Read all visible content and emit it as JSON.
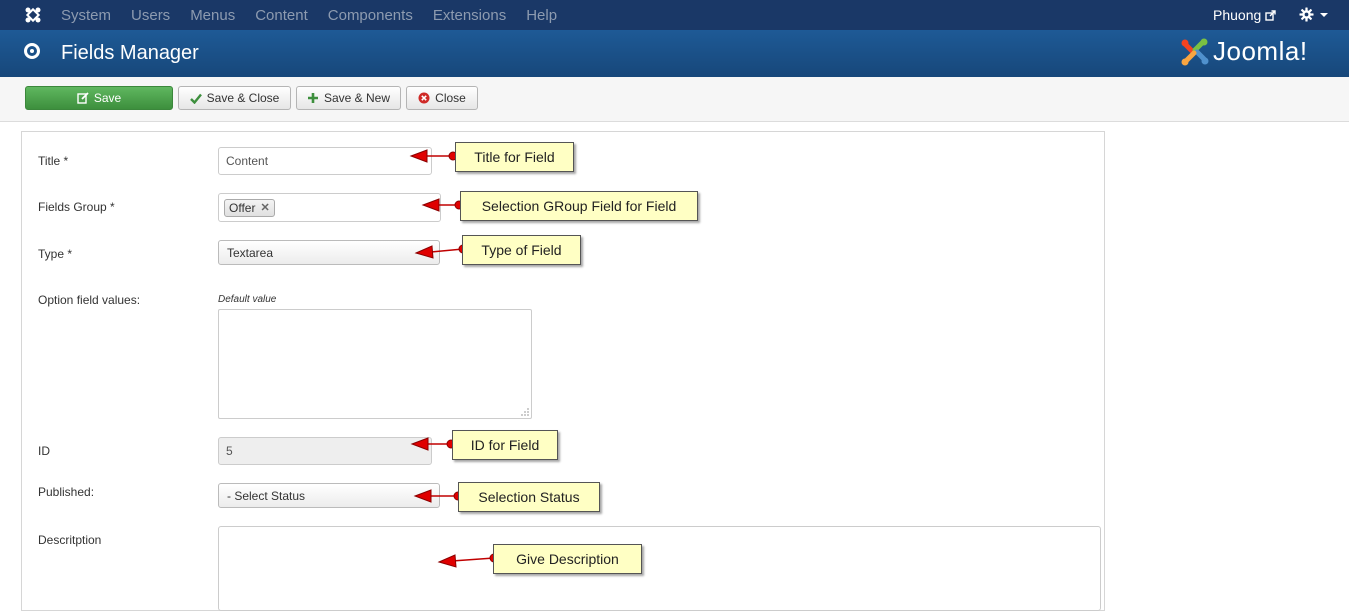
{
  "topnav": {
    "menu": [
      "System",
      "Users",
      "Menus",
      "Content",
      "Components",
      "Extensions",
      "Help"
    ],
    "user": "Phuong"
  },
  "header": {
    "title": "Fields Manager",
    "brand": "Joomla!"
  },
  "toolbar": {
    "save": "Save",
    "save_close": "Save & Close",
    "save_new": "Save & New",
    "close": "Close"
  },
  "form": {
    "title_label": "Title *",
    "title_value": "Content",
    "group_label": "Fields Group *",
    "group_tag": "Offer",
    "type_label": "Type *",
    "type_value": "Textarea",
    "options_label": "Option field values:",
    "default_hint": "Default value",
    "id_label": "ID",
    "id_value": "5",
    "published_label": "Published:",
    "published_value": "- Select Status",
    "description_label": "Descritption"
  },
  "annotations": {
    "title": "Title for Field",
    "group": "Selection GRoup Field for Field",
    "type": "Type of Field",
    "id": "ID for Field",
    "status": "Selection Status",
    "description": "Give Description"
  },
  "colors": {
    "topnav": "#1a3867",
    "header": "#1e5a96",
    "save_button": "#4aa54a",
    "callout": "#ffffc4",
    "arrow": "#e00000"
  }
}
